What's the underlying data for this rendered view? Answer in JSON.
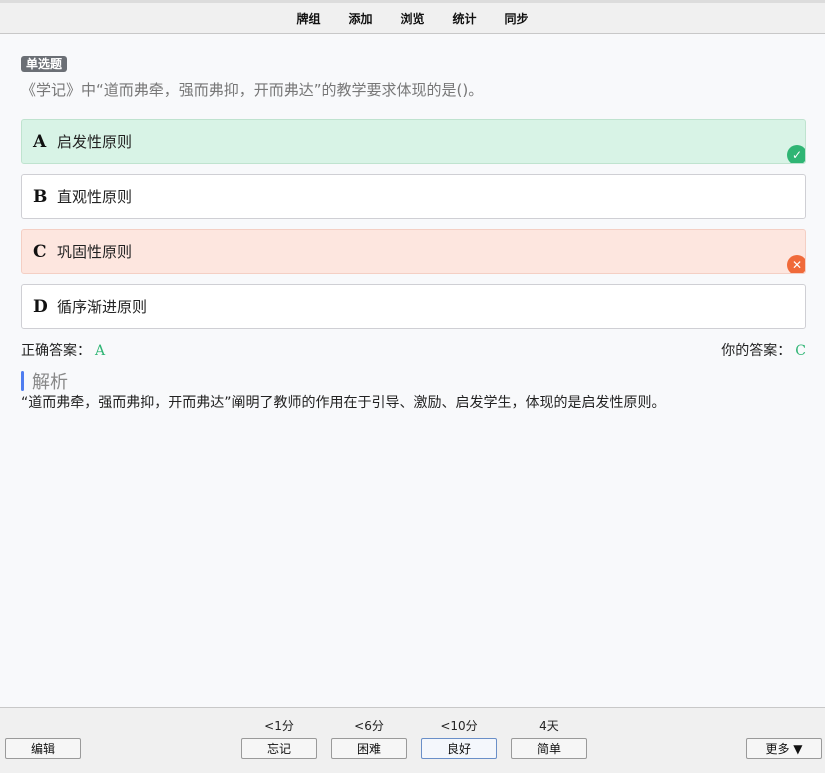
{
  "nav": [
    "牌组",
    "添加",
    "浏览",
    "统计",
    "同步"
  ],
  "question": {
    "type": "单选题",
    "text": "《学记》中“道而弗牵，强而弗抑，开而弗达”的教学要求体现的是()。"
  },
  "options": [
    {
      "letter": "A",
      "text": "启发性原则",
      "state": "correct",
      "mark": "✓"
    },
    {
      "letter": "B",
      "text": "直观性原则",
      "state": "normal",
      "mark": ""
    },
    {
      "letter": "C",
      "text": "巩固性原则",
      "state": "wrong",
      "mark": "✕"
    },
    {
      "letter": "D",
      "text": "循序渐进原则",
      "state": "normal",
      "mark": ""
    }
  ],
  "answer": {
    "correct_label": "正确答案：",
    "correct_value": "A",
    "yours_label": "你的答案：",
    "yours_value": "C"
  },
  "analysis": {
    "title": "解析",
    "text": "“道而弗牵，强而弗抑，开而弗达”阐明了教师的作用在于引导、激励、启发学生，体现的是启发性原则。"
  },
  "bottom": {
    "edit": "编辑",
    "more": "更多 ▼",
    "ease": [
      {
        "time": "<1分",
        "label": "忘记"
      },
      {
        "time": "<6分",
        "label": "困难"
      },
      {
        "time": "<10分",
        "label": "良好"
      },
      {
        "time": "4天",
        "label": "简单"
      }
    ]
  },
  "colors": {
    "correct": "#2fb574",
    "wrong": "#f06a3a",
    "accent": "#4f7df0"
  }
}
